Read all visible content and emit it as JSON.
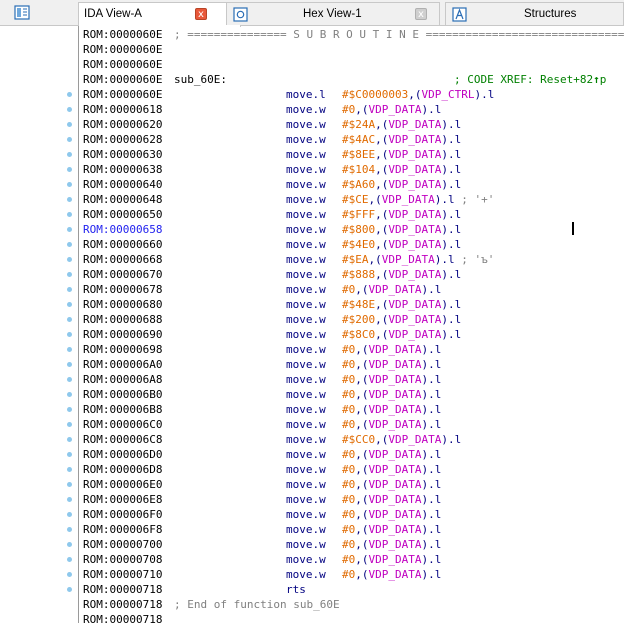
{
  "tabs": [
    {
      "label": "IDA View-A",
      "close": "x",
      "active": true
    },
    {
      "label": "Hex View-1",
      "close": "x",
      "active": false
    },
    {
      "label": "Structures",
      "active": false
    }
  ],
  "colors": {
    "address": "#000000",
    "selected_address": "#2222ee",
    "mnemonic": "#000080",
    "immediate": "#e06a00",
    "symbol": "#c000c0",
    "comment": "#808080",
    "xref": "#008000",
    "dot": "#8ec8ec"
  },
  "code": {
    "separator": "; =============== S U B R O U T I N E =======================================",
    "func_label": "sub_60E:",
    "xref_comment": "; CODE XREF: Reset+82",
    "xref_arrow": "↑",
    "xref_tail": "p",
    "end_comment": "; End of function sub_60E",
    "lines": [
      {
        "addr": "ROM:0000060E",
        "kind": "sep"
      },
      {
        "addr": "ROM:0000060E"
      },
      {
        "addr": "ROM:0000060E"
      },
      {
        "addr": "ROM:0000060E",
        "kind": "label"
      },
      {
        "addr": "ROM:0000060E",
        "mn": "move.l",
        "imm": "#$C0000003",
        "sym": "VDP_CTRL",
        "suffix": ".l",
        "dot": true
      },
      {
        "addr": "ROM:00000618",
        "mn": "move.w",
        "imm": "#0",
        "sym": "VDP_DATA",
        "suffix": ".l",
        "dot": true
      },
      {
        "addr": "ROM:00000620",
        "mn": "move.w",
        "imm": "#$24A",
        "sym": "VDP_DATA",
        "suffix": ".l",
        "dot": true
      },
      {
        "addr": "ROM:00000628",
        "mn": "move.w",
        "imm": "#$4AC",
        "sym": "VDP_DATA",
        "suffix": ".l",
        "dot": true
      },
      {
        "addr": "ROM:00000630",
        "mn": "move.w",
        "imm": "#$8EE",
        "sym": "VDP_DATA",
        "suffix": ".l",
        "dot": true
      },
      {
        "addr": "ROM:00000638",
        "mn": "move.w",
        "imm": "#$104",
        "sym": "VDP_DATA",
        "suffix": ".l",
        "dot": true
      },
      {
        "addr": "ROM:00000640",
        "mn": "move.w",
        "imm": "#$A60",
        "sym": "VDP_DATA",
        "suffix": ".l",
        "dot": true
      },
      {
        "addr": "ROM:00000648",
        "mn": "move.w",
        "imm": "#$CE",
        "sym": "VDP_DATA",
        "suffix": ".l",
        "cmt": " ; '+'",
        "dot": true
      },
      {
        "addr": "ROM:00000650",
        "mn": "move.w",
        "imm": "#$FFF",
        "sym": "VDP_DATA",
        "suffix": ".l",
        "dot": true
      },
      {
        "addr": "ROM:00000658",
        "mn": "move.w",
        "imm": "#$800",
        "sym": "VDP_DATA",
        "suffix": ".l",
        "dot": true,
        "selected": true
      },
      {
        "addr": "ROM:00000660",
        "mn": "move.w",
        "imm": "#$4E0",
        "sym": "VDP_DATA",
        "suffix": ".l",
        "dot": true
      },
      {
        "addr": "ROM:00000668",
        "mn": "move.w",
        "imm": "#$EA",
        "sym": "VDP_DATA",
        "suffix": ".l",
        "cmt": " ; 'ъ'",
        "dot": true
      },
      {
        "addr": "ROM:00000670",
        "mn": "move.w",
        "imm": "#$888",
        "sym": "VDP_DATA",
        "suffix": ".l",
        "dot": true
      },
      {
        "addr": "ROM:00000678",
        "mn": "move.w",
        "imm": "#0",
        "sym": "VDP_DATA",
        "suffix": ".l",
        "dot": true
      },
      {
        "addr": "ROM:00000680",
        "mn": "move.w",
        "imm": "#$48E",
        "sym": "VDP_DATA",
        "suffix": ".l",
        "dot": true
      },
      {
        "addr": "ROM:00000688",
        "mn": "move.w",
        "imm": "#$200",
        "sym": "VDP_DATA",
        "suffix": ".l",
        "dot": true
      },
      {
        "addr": "ROM:00000690",
        "mn": "move.w",
        "imm": "#$8C0",
        "sym": "VDP_DATA",
        "suffix": ".l",
        "dot": true
      },
      {
        "addr": "ROM:00000698",
        "mn": "move.w",
        "imm": "#0",
        "sym": "VDP_DATA",
        "suffix": ".l",
        "dot": true
      },
      {
        "addr": "ROM:000006A0",
        "mn": "move.w",
        "imm": "#0",
        "sym": "VDP_DATA",
        "suffix": ".l",
        "dot": true
      },
      {
        "addr": "ROM:000006A8",
        "mn": "move.w",
        "imm": "#0",
        "sym": "VDP_DATA",
        "suffix": ".l",
        "dot": true
      },
      {
        "addr": "ROM:000006B0",
        "mn": "move.w",
        "imm": "#0",
        "sym": "VDP_DATA",
        "suffix": ".l",
        "dot": true
      },
      {
        "addr": "ROM:000006B8",
        "mn": "move.w",
        "imm": "#0",
        "sym": "VDP_DATA",
        "suffix": ".l",
        "dot": true
      },
      {
        "addr": "ROM:000006C0",
        "mn": "move.w",
        "imm": "#0",
        "sym": "VDP_DATA",
        "suffix": ".l",
        "dot": true
      },
      {
        "addr": "ROM:000006C8",
        "mn": "move.w",
        "imm": "#$CC0",
        "sym": "VDP_DATA",
        "suffix": ".l",
        "dot": true
      },
      {
        "addr": "ROM:000006D0",
        "mn": "move.w",
        "imm": "#0",
        "sym": "VDP_DATA",
        "suffix": ".l",
        "dot": true
      },
      {
        "addr": "ROM:000006D8",
        "mn": "move.w",
        "imm": "#0",
        "sym": "VDP_DATA",
        "suffix": ".l",
        "dot": true
      },
      {
        "addr": "ROM:000006E0",
        "mn": "move.w",
        "imm": "#0",
        "sym": "VDP_DATA",
        "suffix": ".l",
        "dot": true
      },
      {
        "addr": "ROM:000006E8",
        "mn": "move.w",
        "imm": "#0",
        "sym": "VDP_DATA",
        "suffix": ".l",
        "dot": true
      },
      {
        "addr": "ROM:000006F0",
        "mn": "move.w",
        "imm": "#0",
        "sym": "VDP_DATA",
        "suffix": ".l",
        "dot": true
      },
      {
        "addr": "ROM:000006F8",
        "mn": "move.w",
        "imm": "#0",
        "sym": "VDP_DATA",
        "suffix": ".l",
        "dot": true
      },
      {
        "addr": "ROM:00000700",
        "mn": "move.w",
        "imm": "#0",
        "sym": "VDP_DATA",
        "suffix": ".l",
        "dot": true
      },
      {
        "addr": "ROM:00000708",
        "mn": "move.w",
        "imm": "#0",
        "sym": "VDP_DATA",
        "suffix": ".l",
        "dot": true
      },
      {
        "addr": "ROM:00000710",
        "mn": "move.w",
        "imm": "#0",
        "sym": "VDP_DATA",
        "suffix": ".l",
        "dot": true
      },
      {
        "addr": "ROM:00000718",
        "mn": "rts",
        "dot": true
      },
      {
        "addr": "ROM:00000718",
        "kind": "end"
      },
      {
        "addr": "ROM:00000718"
      }
    ]
  }
}
